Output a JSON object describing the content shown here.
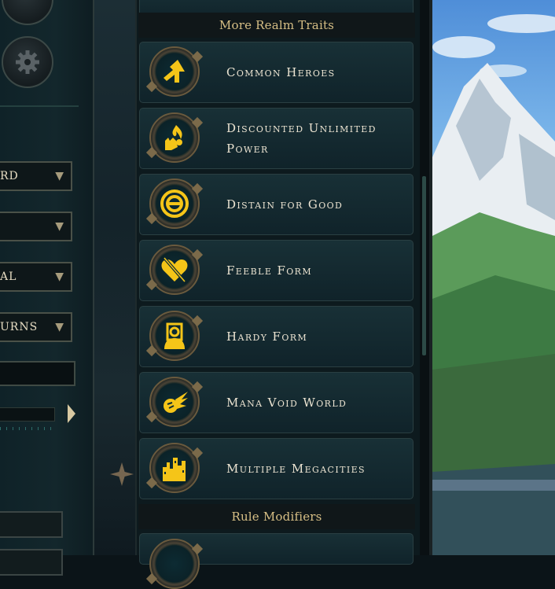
{
  "left_panel": {
    "dropdowns": [
      {
        "label": "RD"
      },
      {
        "label": ""
      },
      {
        "label": "AL"
      },
      {
        "label": "URNS"
      }
    ]
  },
  "list": {
    "section_header": "More Realm Traits",
    "items": [
      {
        "label": "Common Heroes",
        "icon": "arrow-icon"
      },
      {
        "label": "Discounted Unlimited Power",
        "icon": "fire-hand-icon"
      },
      {
        "label": "Distain for Good",
        "icon": "target-icon"
      },
      {
        "label": "Feeble Form",
        "icon": "broken-heart-icon"
      },
      {
        "label": "Hardy Form",
        "icon": "figure-icon"
      },
      {
        "label": "Mana Void World",
        "icon": "flaming-orb-icon"
      },
      {
        "label": "Multiple Megacities",
        "icon": "city-icon"
      }
    ],
    "next_section_header": "Rule Modifiers"
  },
  "colors": {
    "gold": "#f5c518",
    "header_text": "#d7bf85",
    "row_text": "#ece4d2"
  }
}
